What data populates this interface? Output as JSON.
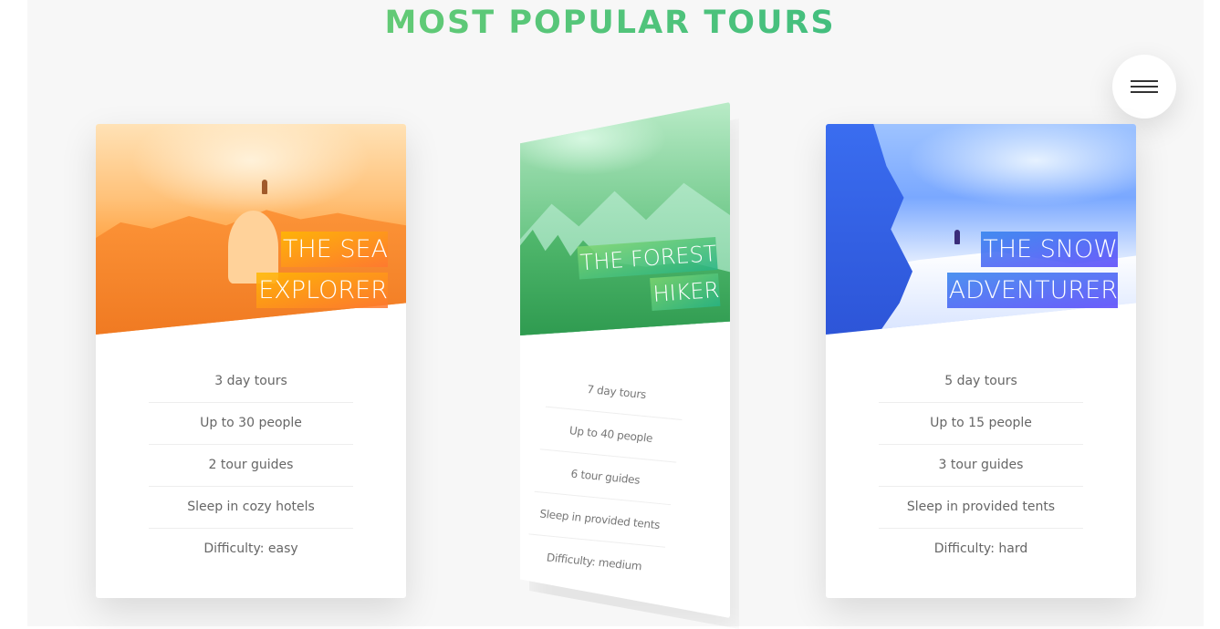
{
  "section": {
    "heading": "MOST POPULAR TOURS"
  },
  "navigation": {
    "icon": "hamburger-menu-icon"
  },
  "colors": {
    "heading_gradient": [
      "#7ed56f",
      "#28b485"
    ],
    "card_1_accent": [
      "#ffb900",
      "#ff7730"
    ],
    "card_2_accent": [
      "#7ed56f",
      "#28b485"
    ],
    "card_3_accent": [
      "#2f80ed",
      "#5643fa"
    ]
  },
  "cards": [
    {
      "title_line_1": "THE SEA",
      "title_line_2": "EXPLORER",
      "details": [
        "3 day tours",
        "Up to 30 people",
        "2 tour guides",
        "Sleep in cozy hotels",
        "Difficulty: easy"
      ]
    },
    {
      "title_line_1": "THE FOREST",
      "title_line_2": "HIKER",
      "details": [
        "7 day tours",
        "Up to 40 people",
        "6 tour guides",
        "Sleep in provided tents",
        "Difficulty: medium"
      ]
    },
    {
      "title_line_1": "THE SNOW",
      "title_line_2": "ADVENTURER",
      "details": [
        "5 day tours",
        "Up to 15 people",
        "3 tour guides",
        "Sleep in provided tents",
        "Difficulty: hard"
      ]
    }
  ]
}
